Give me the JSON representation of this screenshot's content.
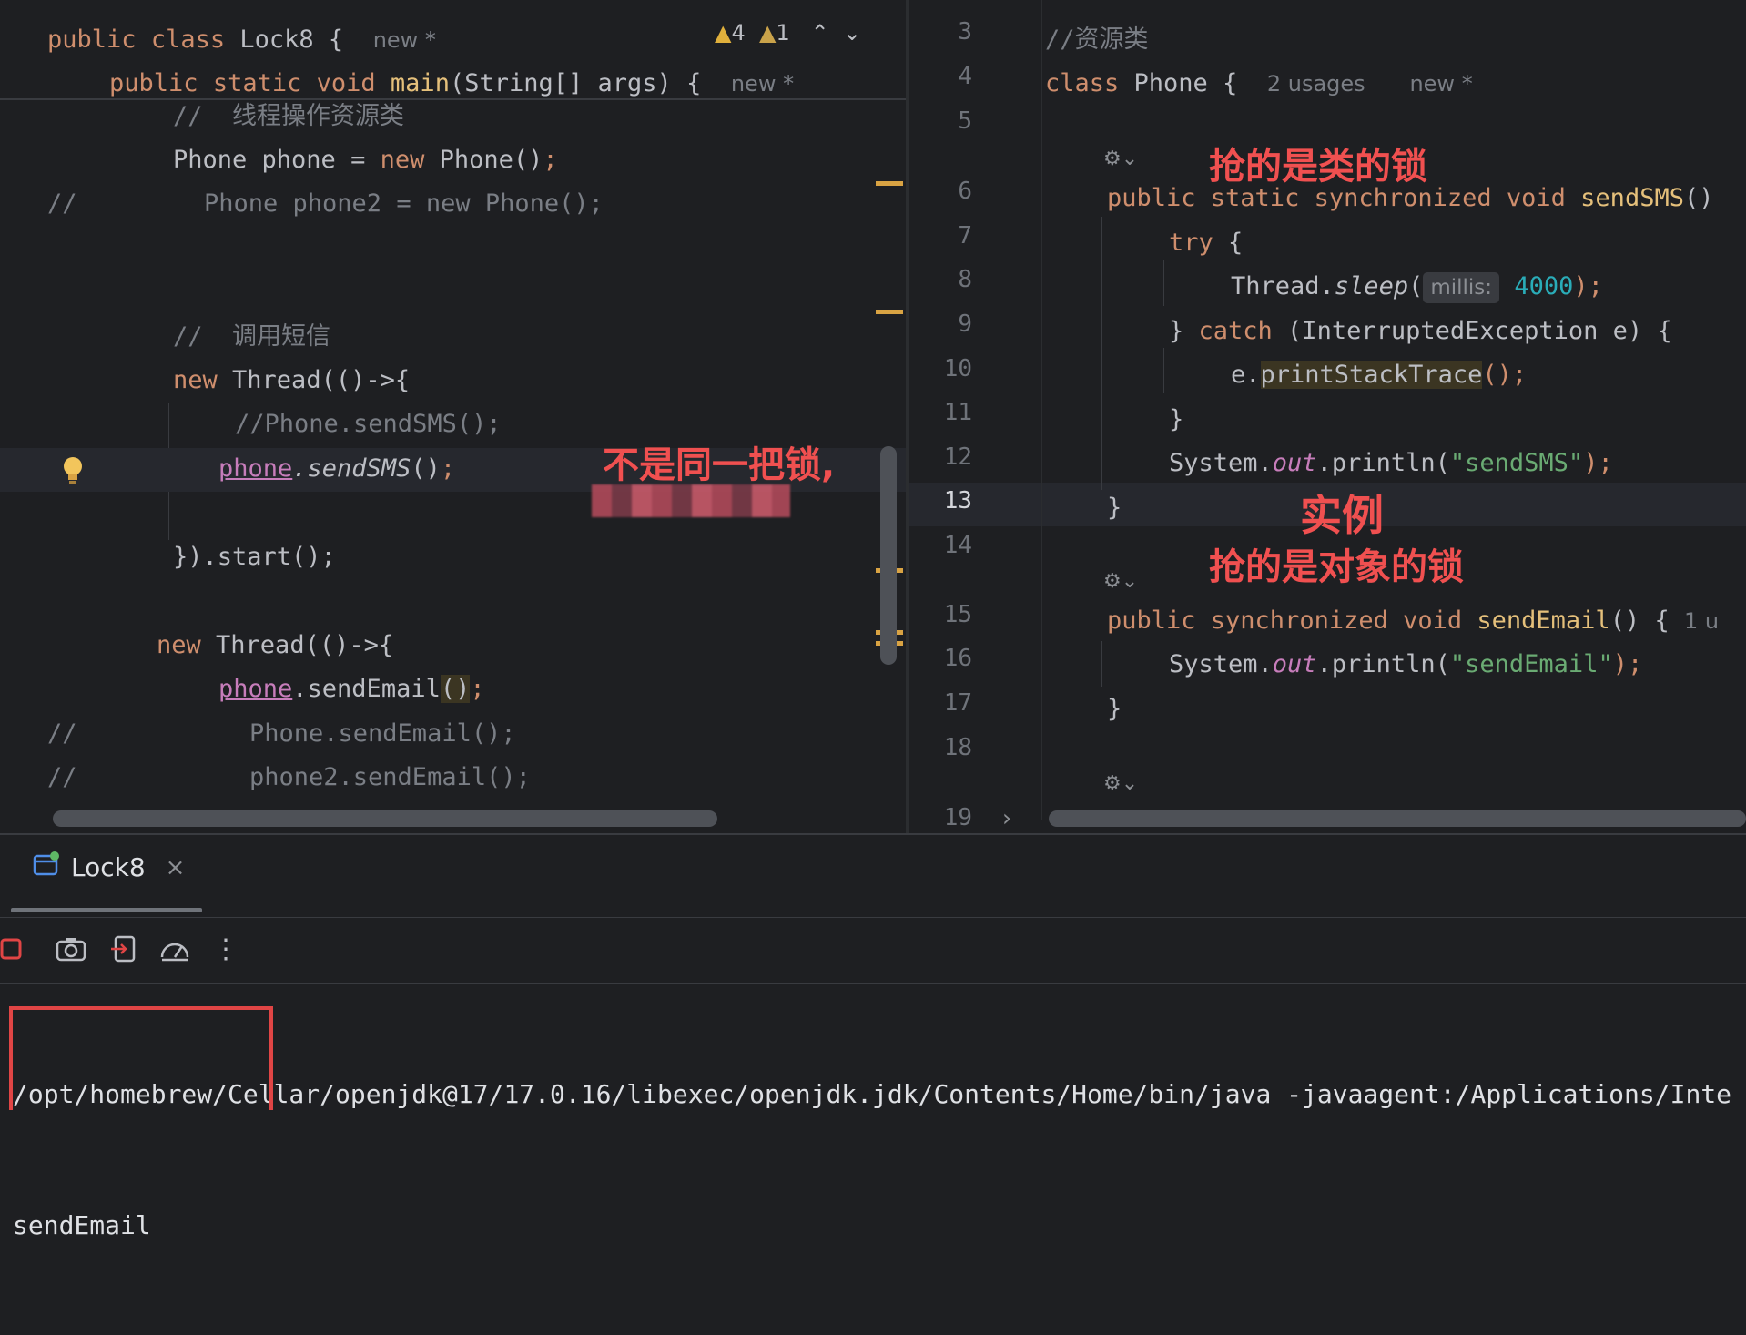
{
  "left_editor": {
    "sticky": {
      "l1": {
        "kw1": "public",
        "kw2": "class",
        "name": "Lock8",
        "brace": "{",
        "hint": "new *"
      },
      "l2": {
        "kw1": "public",
        "kw2": "static",
        "kw3": "void",
        "fn": "main",
        "params": "(String[] args)",
        "brace": "{",
        "hint": "new *"
      }
    },
    "inspections": {
      "warnings": "4",
      "weak_warnings": "1"
    },
    "lines": {
      "c1": "//  线程操作资源类",
      "l2_type": "Phone phone = ",
      "l2_kw": "new",
      "l2_rest": " Phone()",
      "semi": ";",
      "c3_gutter": "//",
      "c3": "Phone phone2 = new Phone();",
      "c4": "//  调用短信",
      "l5_kw": "new",
      "l5_rest": " Thread(()->{",
      "c6": "//Phone.sendSMS();",
      "l7_var": "phone",
      "l7_call": ".sendSMS",
      "l7_paren": "()",
      "l8": "}).start();",
      "l9_kw": "new",
      "l9_rest": " Thread(()->{",
      "l10_var": "phone",
      "l10_call": ".sendEmail",
      "l10_paren": "()",
      "c11_gutter": "//",
      "c11": "Phone.sendEmail();",
      "c12_gutter": "//",
      "c12": "phone2.sendEmail();"
    },
    "annotation": "不是同一把锁,"
  },
  "right_editor": {
    "line_numbers": [
      "3",
      "4",
      "5",
      "",
      "6",
      "7",
      "8",
      "9",
      "10",
      "11",
      "12",
      "13",
      "14",
      "",
      "15",
      "16",
      "17",
      "18",
      "",
      "19"
    ],
    "lines": {
      "l3": "//资源类",
      "l4_kw": "class",
      "l4_name": " Phone {",
      "l4_hint1": "2 usages",
      "l4_hint2": "new *",
      "l6_kw": "public static synchronized void ",
      "l6_fn": "sendSMS",
      "l6_rest": "()",
      "l7_kw": "try",
      "l7_rest": " {",
      "l8_a": "Thread.",
      "l8_fn": "sleep",
      "l8_p": "(",
      "l8_inlay": "millis:",
      "l8_num": "4000",
      "l8_end": ");",
      "l9_a": "} ",
      "l9_kw": "catch",
      "l9_rest": " (InterruptedException e) {",
      "l10_a": "e.",
      "l10_fn": "printStackTrace",
      "l10_end": "();",
      "l11": "}",
      "l12_a": "System.",
      "l12_out": "out",
      "l12_b": ".println(",
      "l12_str": "\"sendSMS\"",
      "l12_end": ");",
      "l13": "}",
      "l15_kw": "public synchronized void ",
      "l15_fn": "sendEmail",
      "l15_rest": "() {",
      "l15_hint": "1 u",
      "l16_a": "System.",
      "l16_out": "out",
      "l16_b": ".println(",
      "l16_str": "\"sendEmail\"",
      "l16_end": ");",
      "l17": "}"
    },
    "annotations": {
      "a1": "抢的是类的锁",
      "a2": "实例",
      "a3": "抢的是对象的锁"
    }
  },
  "run_panel": {
    "tab_label": "Lock8",
    "console_lines": [
      "/opt/homebrew/Cellar/openjdk@17/17.0.16/libexec/openjdk.jdk/Contents/Home/bin/java -javaagent:/Applications/Inte",
      "sendEmail"
    ]
  },
  "colors": {
    "keyword": "#cf8e6d",
    "method": "#56a8f5",
    "string": "#6aab73",
    "annotation": "#f05050",
    "background": "#1e1f22"
  }
}
